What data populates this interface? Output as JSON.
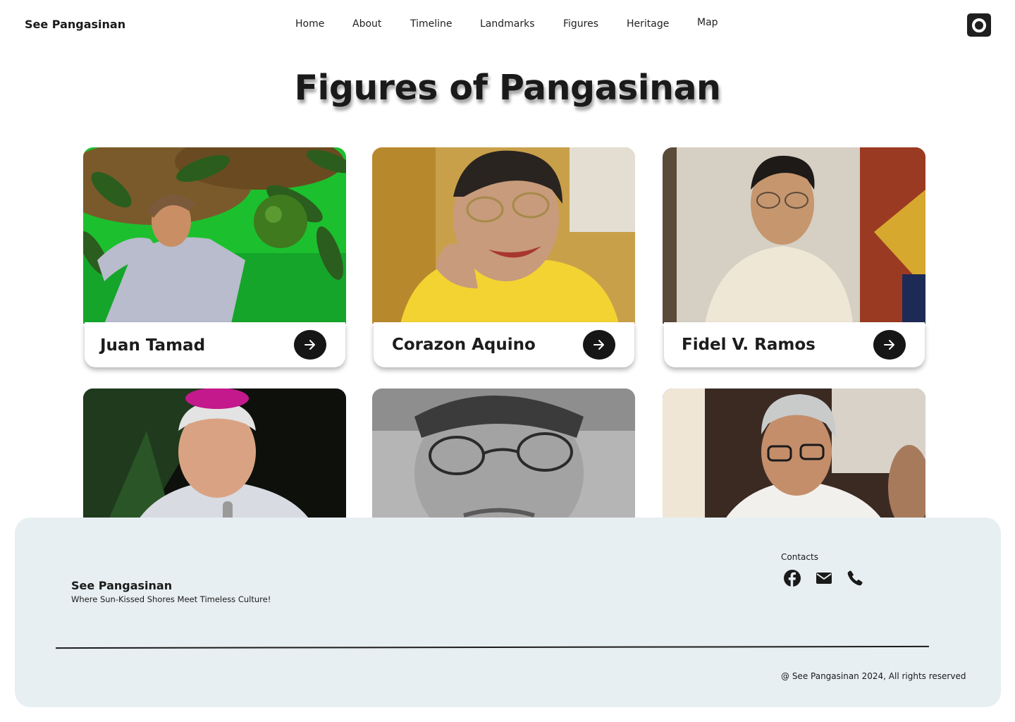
{
  "header": {
    "brand": "See Pangasinan",
    "nav": [
      "Home",
      "About",
      "Timeline",
      "Landmarks",
      "Figures",
      "Heritage",
      "Map"
    ]
  },
  "page": {
    "title": "Figures of Pangasinan"
  },
  "figures": [
    {
      "name": "Juan Tamad"
    },
    {
      "name": "Corazon Aquino"
    },
    {
      "name": "Fidel V. Ramos"
    }
  ],
  "footer": {
    "brand": "See Pangasinan",
    "tagline": "Where Sun-Kissed Shores Meet Timeless Culture!",
    "contacts_label": "Contacts",
    "contact_icons": [
      "facebook-icon",
      "mail-icon",
      "phone-icon"
    ],
    "copyright": "@ See Pangasinan 2024, All rights reserved"
  }
}
